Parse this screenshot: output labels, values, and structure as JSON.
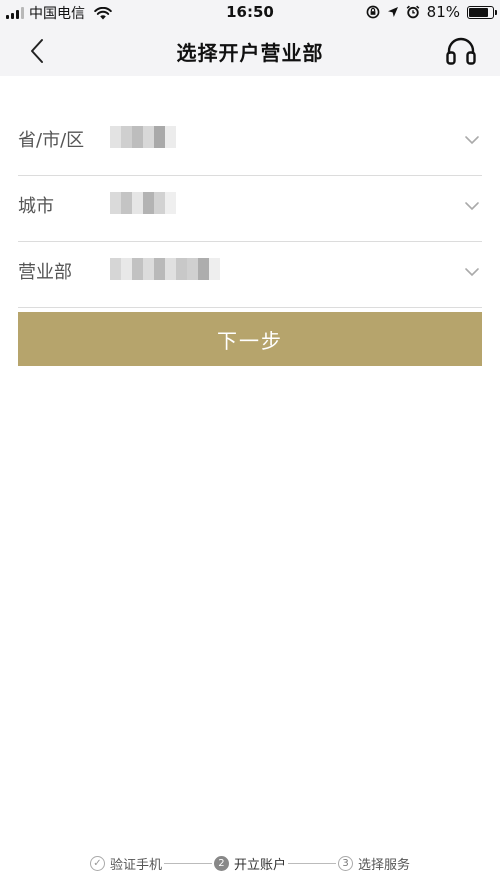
{
  "status_bar": {
    "carrier": "中国电信",
    "time": "16:50",
    "battery": "81%",
    "battery_level": 0.81,
    "icons": [
      "signal-icon",
      "wifi-icon",
      "rotation-lock-icon",
      "location-icon",
      "alarm-icon",
      "battery-icon"
    ]
  },
  "nav": {
    "title": "选择开户营业部",
    "back_icon": "chevron-left-icon",
    "service_icon": "headphones-icon"
  },
  "form": {
    "rows": [
      {
        "label": "省/市/区",
        "value": "",
        "chevron": "chevron-down-icon"
      },
      {
        "label": "城市",
        "value": "",
        "chevron": "chevron-down-icon"
      },
      {
        "label": "营业部",
        "value": "",
        "chevron": "chevron-down-icon"
      }
    ]
  },
  "next_button": {
    "label": "下一步"
  },
  "steps": [
    {
      "label": "验证手机",
      "marker": "✓",
      "state": "done"
    },
    {
      "label": "开立账户",
      "marker": "2",
      "state": "active"
    },
    {
      "label": "选择服务",
      "marker": "3",
      "state": "todo"
    }
  ],
  "colors": {
    "accent": "#b6a46c",
    "nav_background": "#f4f4f6"
  }
}
